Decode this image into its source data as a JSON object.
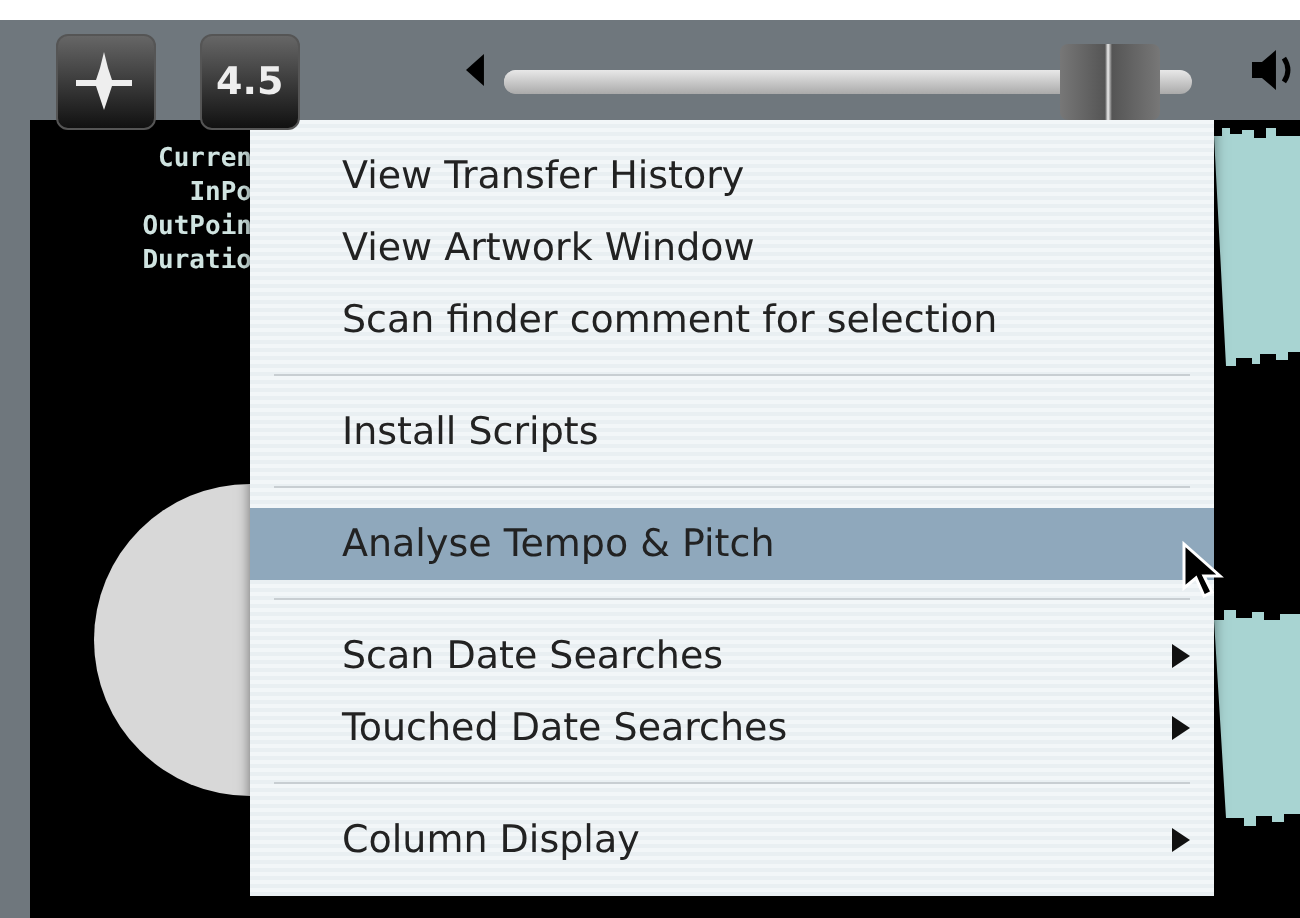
{
  "toolbar": {
    "version_button": "4.5",
    "volume": {
      "level": 0.88
    }
  },
  "info_labels": [
    "Curren",
    "InPo",
    "OutPoin",
    "Duratio"
  ],
  "menu": {
    "items": [
      {
        "kind": "item",
        "label": "View Transfer History",
        "selected": false,
        "has_submenu": false
      },
      {
        "kind": "item",
        "label": "View Artwork Window",
        "selected": false,
        "has_submenu": false
      },
      {
        "kind": "item",
        "label": "Scan finder comment for selection",
        "selected": false,
        "has_submenu": false
      },
      {
        "kind": "separator"
      },
      {
        "kind": "item",
        "label": "Install Scripts",
        "selected": false,
        "has_submenu": false
      },
      {
        "kind": "separator"
      },
      {
        "kind": "item",
        "label": "Analyse Tempo & Pitch",
        "selected": true,
        "has_submenu": false
      },
      {
        "kind": "separator"
      },
      {
        "kind": "item",
        "label": "Scan Date Searches",
        "selected": false,
        "has_submenu": true
      },
      {
        "kind": "item",
        "label": "Touched Date Searches",
        "selected": false,
        "has_submenu": true
      },
      {
        "kind": "separator"
      },
      {
        "kind": "item",
        "label": "Column Display",
        "selected": false,
        "has_submenu": true
      }
    ]
  }
}
